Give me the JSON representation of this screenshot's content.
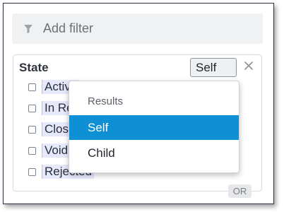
{
  "filter_bar": {
    "add_filter_label": "Add filter",
    "icon": "filter-funnel-icon"
  },
  "state_filter": {
    "label": "State",
    "mode_value": "Self",
    "remove_icon": "close-icon",
    "options": [
      {
        "label": "Active"
      },
      {
        "label": "In Review"
      },
      {
        "label": "Closed"
      },
      {
        "label": "Void"
      },
      {
        "label": "Rejected"
      }
    ],
    "combine_badge": "OR"
  },
  "dropdown": {
    "header": "Results",
    "items": [
      {
        "label": "Self",
        "selected": true
      },
      {
        "label": "Child",
        "selected": false
      }
    ]
  },
  "colors": {
    "accent": "#0f8fd4",
    "highlight": "#e6e8fb"
  }
}
